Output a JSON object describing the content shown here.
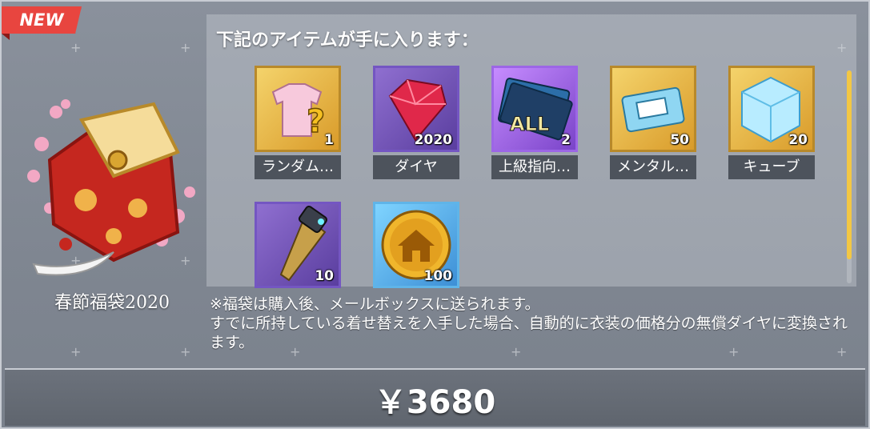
{
  "badge": {
    "label": "NEW"
  },
  "product": {
    "name": "春節福袋2020"
  },
  "items_section": {
    "title": "下記のアイテムが手に入ります："
  },
  "items": [
    {
      "label": "ランダム…",
      "qty": "1",
      "icon": "random-outfit-icon"
    },
    {
      "label": "ダイヤ",
      "qty": "2020",
      "icon": "diamond-icon"
    },
    {
      "label": "上級指向…",
      "qty": "2",
      "icon": "advanced-ticket-icon"
    },
    {
      "label": "メンタル…",
      "qty": "50",
      "icon": "mental-chip-icon"
    },
    {
      "label": "キューブ",
      "qty": "20",
      "icon": "cube-icon"
    },
    {
      "label": "",
      "qty": "10",
      "icon": "drill-icon"
    },
    {
      "label": "",
      "qty": "100",
      "icon": "home-coin-icon"
    }
  ],
  "notes": {
    "line1": "※福袋は購入後、メールボックスに送られます。",
    "line2": "すでに所持している着せ替えを入手した場合、自動的に衣装の価格分の無償ダイヤに変換されます。"
  },
  "price": {
    "label": "￥3680"
  },
  "colors": {
    "accent": "#f3c744",
    "badge": "#e8453f"
  }
}
